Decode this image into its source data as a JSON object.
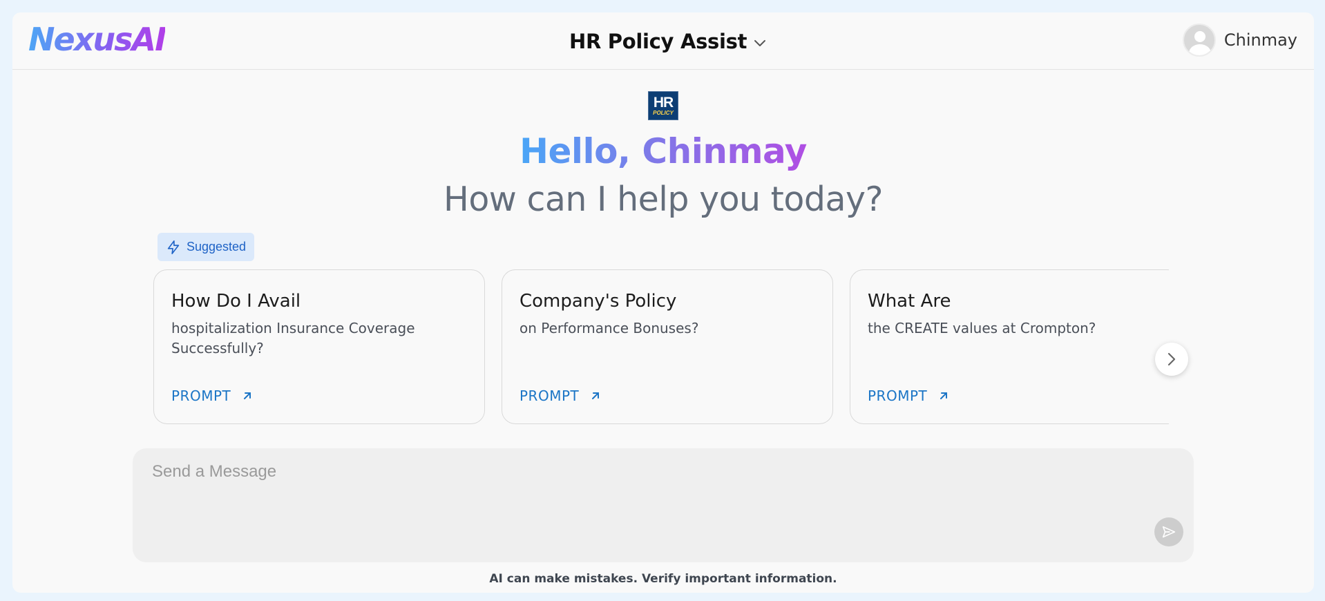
{
  "header": {
    "logo": "NexusAI",
    "assistant_name": "HR Policy Assist",
    "user_name": "Chinmay"
  },
  "hero": {
    "badge_top": "HR",
    "badge_bottom": "POLICY",
    "greeting": "Hello, Chinmay",
    "subtitle": "How can I help you today?"
  },
  "suggested": {
    "label": "Suggested",
    "cards": [
      {
        "title": "How Do I Avail",
        "description": "hospitalization Insurance Coverage Successfully?",
        "action": "PROMPT"
      },
      {
        "title": "Company's Policy",
        "description": "on Performance Bonuses?",
        "action": "PROMPT"
      },
      {
        "title": "What Are",
        "description": "the CREATE values at Crompton?",
        "action": "PROMPT"
      }
    ]
  },
  "composer": {
    "placeholder": "Send a Message"
  },
  "footer": {
    "disclaimer": "AI can make mistakes. Verify important information."
  },
  "colors": {
    "accent_blue": "#1b75c6",
    "gradient_start": "#4aa6f7",
    "gradient_end": "#b04ee3",
    "page_background": "#eaf4fd"
  }
}
